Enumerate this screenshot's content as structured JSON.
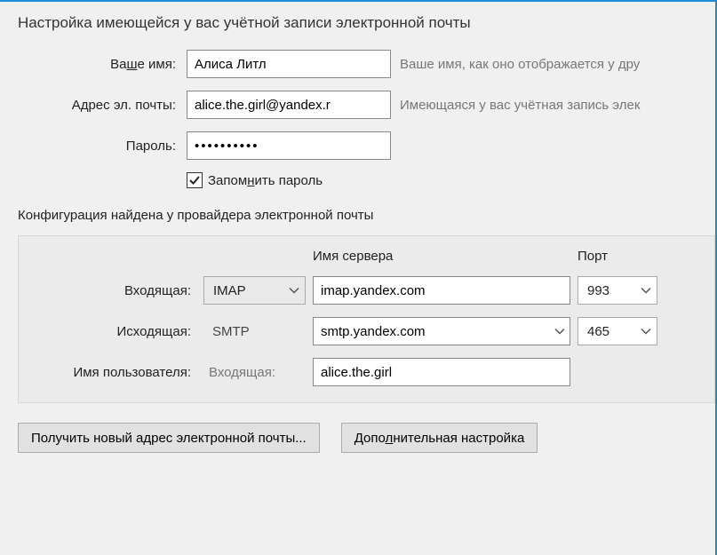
{
  "title": "Настройка имеющейся у вас учётной записи электронной почты",
  "identity": {
    "name_label_pre": "Ва",
    "name_label_u": "ш",
    "name_label_post": "е имя:",
    "name_value": "Алиса Литл",
    "name_hint": "Ваше имя, как оно отображается у дру",
    "email_label": "Адрес эл. почты:",
    "email_value": "alice.the.girl@yandex.r",
    "email_hint": "Имеющаяся у вас учётная запись элек",
    "password_label": "Пароль:",
    "password_value": "••••••••••",
    "remember_pre": "Запом",
    "remember_u": "н",
    "remember_post": "ить пароль",
    "remember_checked": true
  },
  "status": "Конфигурация найдена у провайдера электронной почты",
  "config": {
    "header_server": "Имя сервера",
    "header_port": "Порт",
    "incoming_label": "Входящая:",
    "outgoing_label": "Исходящая:",
    "username_label": "Имя пользователя:",
    "protocol_imap": "IMAP",
    "protocol_smtp": "SMTP",
    "incoming_server": "imap.yandex.com",
    "outgoing_server": "smtp.yandex.com",
    "incoming_port": "993",
    "outgoing_port": "465",
    "username_sublabel": "Входящая:",
    "username_value": "alice.the.girl"
  },
  "buttons": {
    "new_address": "Получить новый адрес электронной почты...",
    "advanced_pre": "Допо",
    "advanced_u": "л",
    "advanced_post": "нительная настройка"
  }
}
